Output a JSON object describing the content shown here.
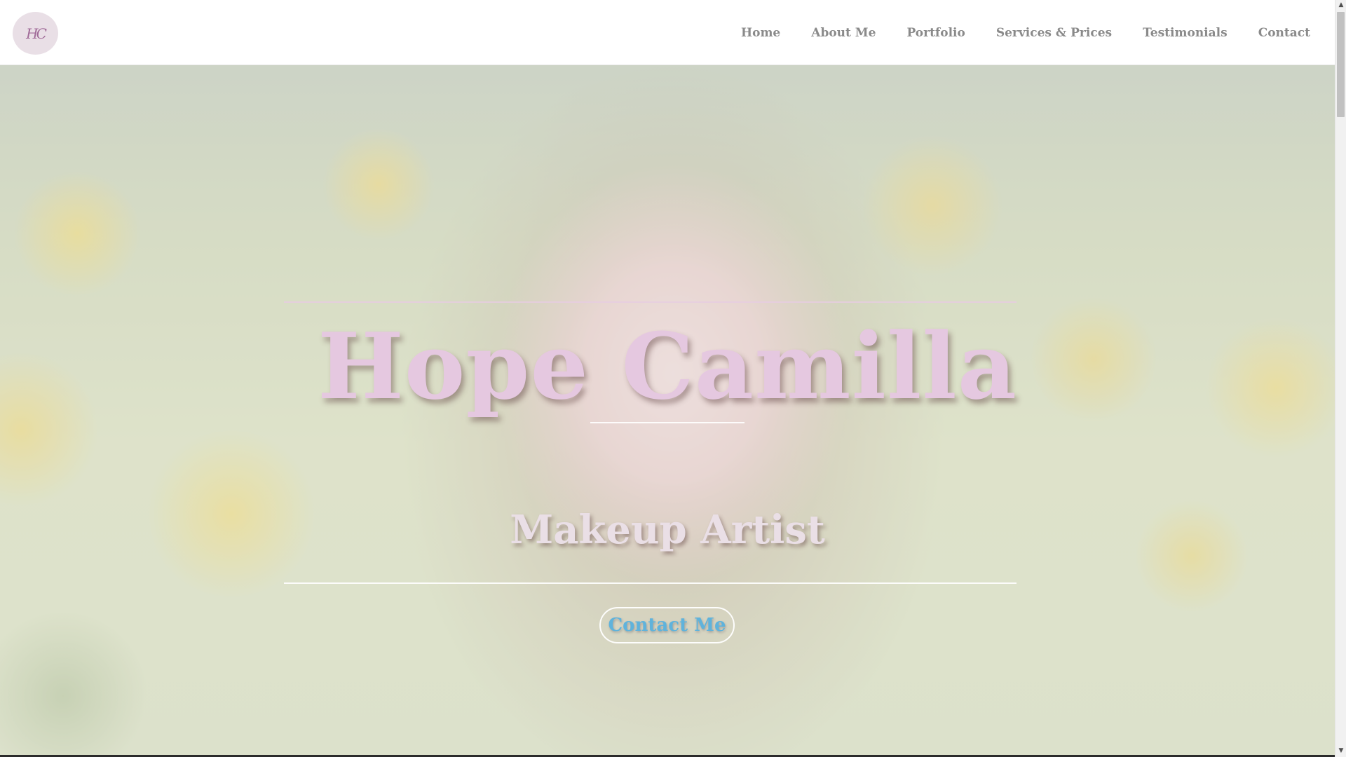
{
  "logo": {
    "monogram": "HC",
    "icon": "hc-monogram-logo"
  },
  "nav": {
    "items": [
      {
        "label": "Home"
      },
      {
        "label": "About Me"
      },
      {
        "label": "Portfolio"
      },
      {
        "label": "Services & Prices"
      },
      {
        "label": "Testimonials"
      },
      {
        "label": "Contact"
      }
    ]
  },
  "hero": {
    "title": "Hope Camilla",
    "subtitle": "Makeup Artist",
    "cta_label": "Contact Me",
    "title_color": "#e5c8e0",
    "cta_color": "#5fb3dc"
  },
  "scrollbar": {
    "up_icon": "scroll-up-arrow-icon",
    "down_icon": "scroll-down-arrow-icon"
  }
}
